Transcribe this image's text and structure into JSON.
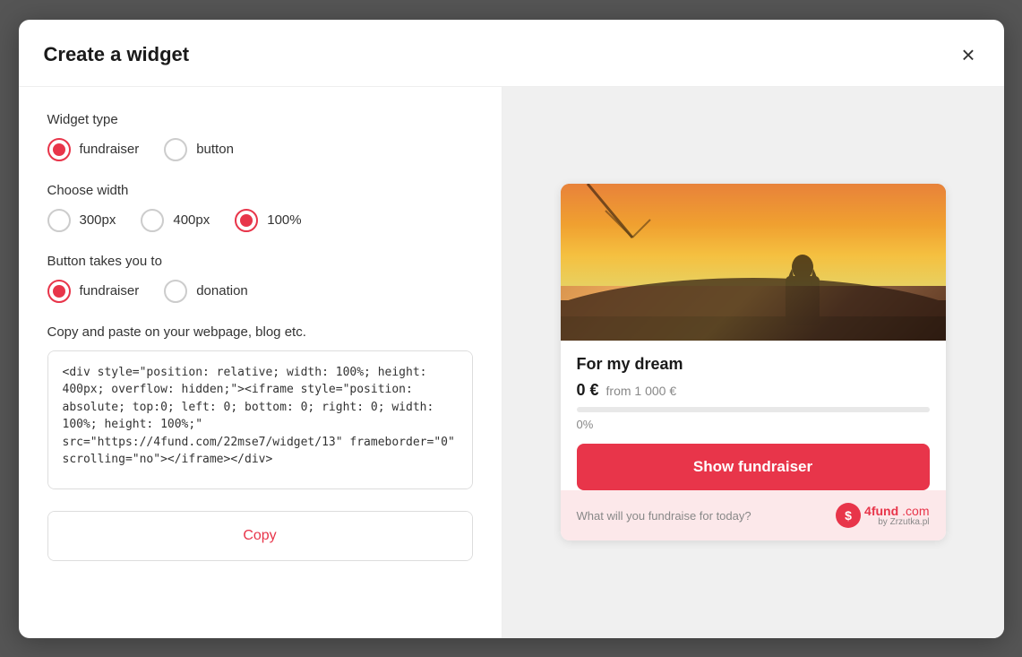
{
  "modal": {
    "title": "Create a widget",
    "close_label": "×"
  },
  "left": {
    "widget_type_label": "Widget type",
    "widget_type_options": [
      {
        "id": "fundraiser",
        "label": "fundraiser",
        "selected": true
      },
      {
        "id": "button",
        "label": "button",
        "selected": false
      }
    ],
    "choose_width_label": "Choose width",
    "width_options": [
      {
        "id": "300px",
        "label": "300px",
        "selected": false
      },
      {
        "id": "400px",
        "label": "400px",
        "selected": false
      },
      {
        "id": "100pct",
        "label": "100%",
        "selected": true
      }
    ],
    "button_takes_label": "Button takes you to",
    "destination_options": [
      {
        "id": "fundraiser",
        "label": "fundraiser",
        "selected": true
      },
      {
        "id": "donation",
        "label": "donation",
        "selected": false
      }
    ],
    "copy_label": "Copy and paste on your webpage, blog etc.",
    "code_value": "<div style=\"position: relative; width: 100%; height: 400px; overflow: hidden;\"><iframe style=\"position: absolute; top:0; left: 0; bottom: 0; right: 0; width: 100%; height: 100%;\" src=\"https://4fund.com/22mse7/widget/13\" frameborder=\"0\" scrolling=\"no\"></iframe></div>",
    "copy_button_label": "Copy"
  },
  "preview": {
    "fundraiser_title": "For my dream",
    "amount": "0 €",
    "from_text": "from 1 000 €",
    "progress_percent": "0%",
    "show_fundraiser_label": "Show fundraiser",
    "footer_text": "What will you fundraise for today?",
    "logo_text": "4fund",
    "logo_com": ".com",
    "logo_by": "by Zrzutka.pl"
  }
}
